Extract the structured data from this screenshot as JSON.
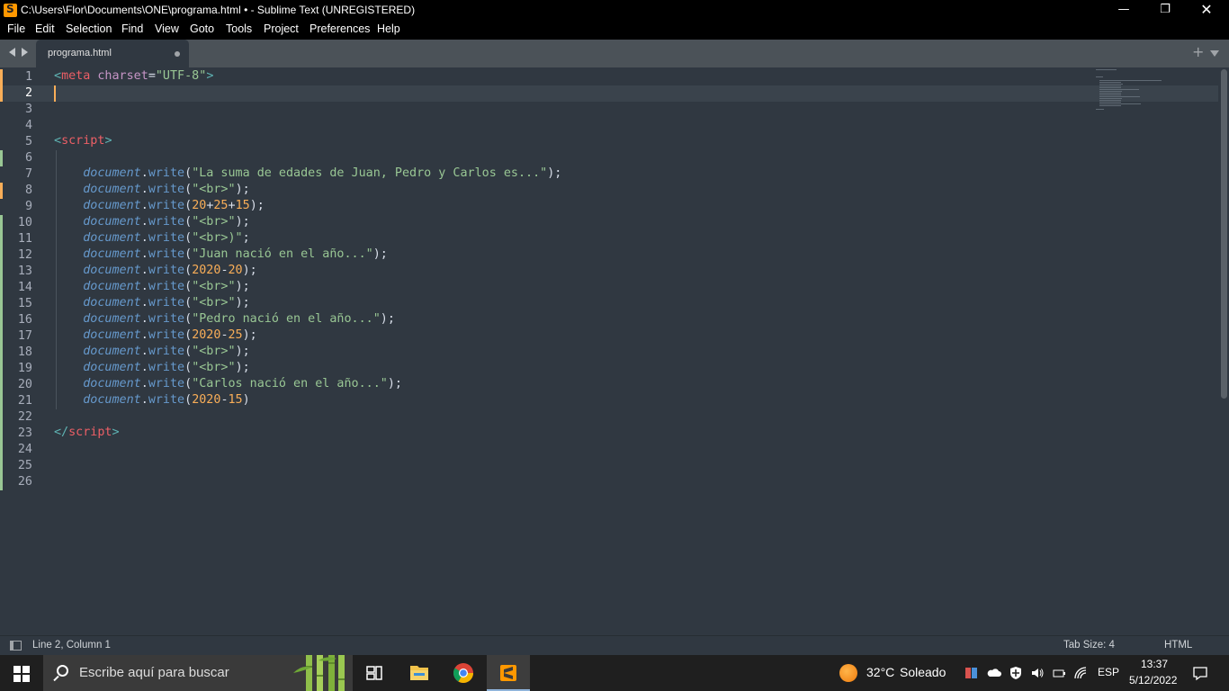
{
  "window": {
    "title": "C:\\Users\\Flor\\Documents\\ONE\\programa.html • - Sublime Text (UNREGISTERED)",
    "minimize_icon": "minimize-icon",
    "maximize_icon": "restore-icon",
    "close_icon": "close-icon"
  },
  "menu": [
    "File",
    "Edit",
    "Selection",
    "Find",
    "View",
    "Goto",
    "Tools",
    "Project",
    "Preferences",
    "Help"
  ],
  "tabs": [
    {
      "label": "programa.html",
      "dirty": true
    }
  ],
  "editor": {
    "active_line": 2,
    "lines": [
      [
        [
          "t-punct",
          "<"
        ],
        [
          "t-tag",
          "meta"
        ],
        [
          "t-plain",
          " "
        ],
        [
          "t-attr",
          "charset"
        ],
        [
          "t-plain",
          "="
        ],
        [
          "t-str",
          "\"UTF-8\""
        ],
        [
          "t-punct",
          ">"
        ]
      ],
      [],
      [],
      [],
      [
        [
          "t-punct",
          "<"
        ],
        [
          "t-tag",
          "script"
        ],
        [
          "t-punct",
          ">"
        ]
      ],
      [],
      [
        [
          "t-plain",
          "    "
        ],
        [
          "t-obj",
          "document"
        ],
        [
          "t-plain",
          "."
        ],
        [
          "t-fn",
          "write"
        ],
        [
          "t-plain",
          "("
        ],
        [
          "t-str",
          "\"La suma de edades de Juan, Pedro y Carlos es...\""
        ],
        [
          "t-plain",
          ");"
        ]
      ],
      [
        [
          "t-plain",
          "    "
        ],
        [
          "t-obj",
          "document"
        ],
        [
          "t-plain",
          "."
        ],
        [
          "t-fn",
          "write"
        ],
        [
          "t-plain",
          "("
        ],
        [
          "t-str",
          "\"<br>\""
        ],
        [
          "t-plain",
          ");"
        ]
      ],
      [
        [
          "t-plain",
          "    "
        ],
        [
          "t-obj",
          "document"
        ],
        [
          "t-plain",
          "."
        ],
        [
          "t-fn",
          "write"
        ],
        [
          "t-plain",
          "("
        ],
        [
          "t-num",
          "20"
        ],
        [
          "t-plain",
          "+"
        ],
        [
          "t-num",
          "25"
        ],
        [
          "t-plain",
          "+"
        ],
        [
          "t-num",
          "15"
        ],
        [
          "t-plain",
          ");"
        ]
      ],
      [
        [
          "t-plain",
          "    "
        ],
        [
          "t-obj",
          "document"
        ],
        [
          "t-plain",
          "."
        ],
        [
          "t-fn",
          "write"
        ],
        [
          "t-plain",
          "("
        ],
        [
          "t-str",
          "\"<br>\""
        ],
        [
          "t-plain",
          ");"
        ]
      ],
      [
        [
          "t-plain",
          "    "
        ],
        [
          "t-obj",
          "document"
        ],
        [
          "t-plain",
          "."
        ],
        [
          "t-fn",
          "write"
        ],
        [
          "t-plain",
          "("
        ],
        [
          "t-str",
          "\"<br>)\""
        ],
        [
          "t-plain",
          ";"
        ]
      ],
      [
        [
          "t-plain",
          "    "
        ],
        [
          "t-obj",
          "document"
        ],
        [
          "t-plain",
          "."
        ],
        [
          "t-fn",
          "write"
        ],
        [
          "t-plain",
          "("
        ],
        [
          "t-str",
          "\"Juan nació en el año...\""
        ],
        [
          "t-plain",
          ");"
        ]
      ],
      [
        [
          "t-plain",
          "    "
        ],
        [
          "t-obj",
          "document"
        ],
        [
          "t-plain",
          "."
        ],
        [
          "t-fn",
          "write"
        ],
        [
          "t-plain",
          "("
        ],
        [
          "t-num",
          "2020"
        ],
        [
          "t-plain",
          "-"
        ],
        [
          "t-num",
          "20"
        ],
        [
          "t-plain",
          ");"
        ]
      ],
      [
        [
          "t-plain",
          "    "
        ],
        [
          "t-obj",
          "document"
        ],
        [
          "t-plain",
          "."
        ],
        [
          "t-fn",
          "write"
        ],
        [
          "t-plain",
          "("
        ],
        [
          "t-str",
          "\"<br>\""
        ],
        [
          "t-plain",
          ");"
        ]
      ],
      [
        [
          "t-plain",
          "    "
        ],
        [
          "t-obj",
          "document"
        ],
        [
          "t-plain",
          "."
        ],
        [
          "t-fn",
          "write"
        ],
        [
          "t-plain",
          "("
        ],
        [
          "t-str",
          "\"<br>\""
        ],
        [
          "t-plain",
          ");"
        ]
      ],
      [
        [
          "t-plain",
          "    "
        ],
        [
          "t-obj",
          "document"
        ],
        [
          "t-plain",
          "."
        ],
        [
          "t-fn",
          "write"
        ],
        [
          "t-plain",
          "("
        ],
        [
          "t-str",
          "\"Pedro nació en el año...\""
        ],
        [
          "t-plain",
          ");"
        ]
      ],
      [
        [
          "t-plain",
          "    "
        ],
        [
          "t-obj",
          "document"
        ],
        [
          "t-plain",
          "."
        ],
        [
          "t-fn",
          "write"
        ],
        [
          "t-plain",
          "("
        ],
        [
          "t-num",
          "2020"
        ],
        [
          "t-plain",
          "-"
        ],
        [
          "t-num",
          "25"
        ],
        [
          "t-plain",
          ");"
        ]
      ],
      [
        [
          "t-plain",
          "    "
        ],
        [
          "t-obj",
          "document"
        ],
        [
          "t-plain",
          "."
        ],
        [
          "t-fn",
          "write"
        ],
        [
          "t-plain",
          "("
        ],
        [
          "t-str",
          "\"<br>\""
        ],
        [
          "t-plain",
          ");"
        ]
      ],
      [
        [
          "t-plain",
          "    "
        ],
        [
          "t-obj",
          "document"
        ],
        [
          "t-plain",
          "."
        ],
        [
          "t-fn",
          "write"
        ],
        [
          "t-plain",
          "("
        ],
        [
          "t-str",
          "\"<br>\""
        ],
        [
          "t-plain",
          ");"
        ]
      ],
      [
        [
          "t-plain",
          "    "
        ],
        [
          "t-obj",
          "document"
        ],
        [
          "t-plain",
          "."
        ],
        [
          "t-fn",
          "write"
        ],
        [
          "t-plain",
          "("
        ],
        [
          "t-str",
          "\"Carlos nació en el año...\""
        ],
        [
          "t-plain",
          ");"
        ]
      ],
      [
        [
          "t-plain",
          "    "
        ],
        [
          "t-obj",
          "document"
        ],
        [
          "t-plain",
          "."
        ],
        [
          "t-fn",
          "write"
        ],
        [
          "t-plain",
          "("
        ],
        [
          "t-num",
          "2020"
        ],
        [
          "t-plain",
          "-"
        ],
        [
          "t-num",
          "15"
        ],
        [
          "t-plain",
          ")"
        ]
      ],
      [],
      [
        [
          "t-punct",
          "</"
        ],
        [
          "t-tag",
          "script"
        ],
        [
          "t-punct",
          ">"
        ]
      ],
      [],
      [],
      []
    ],
    "modified_lines": {
      "orange": [
        1,
        2,
        8
      ],
      "green": [
        6,
        10,
        11,
        12,
        13,
        14,
        15,
        16,
        17,
        18,
        19,
        20,
        21,
        22,
        23,
        24,
        25,
        26
      ]
    }
  },
  "status": {
    "position": "Line 2, Column 1",
    "tab_size": "Tab Size: 4",
    "syntax": "HTML"
  },
  "taskbar": {
    "search_placeholder": "Escribe aquí para buscar",
    "weather_temp": "32°C",
    "weather_desc": "Soleado",
    "language": "ESP",
    "time": "13:37",
    "date": "5/12/2022"
  },
  "colors": {
    "editor_bg": "#303841",
    "tab_strip_bg": "#4b5258",
    "modified_orange": "#f9ae58",
    "added_green": "#99c794",
    "caret": "#f9ae58"
  }
}
